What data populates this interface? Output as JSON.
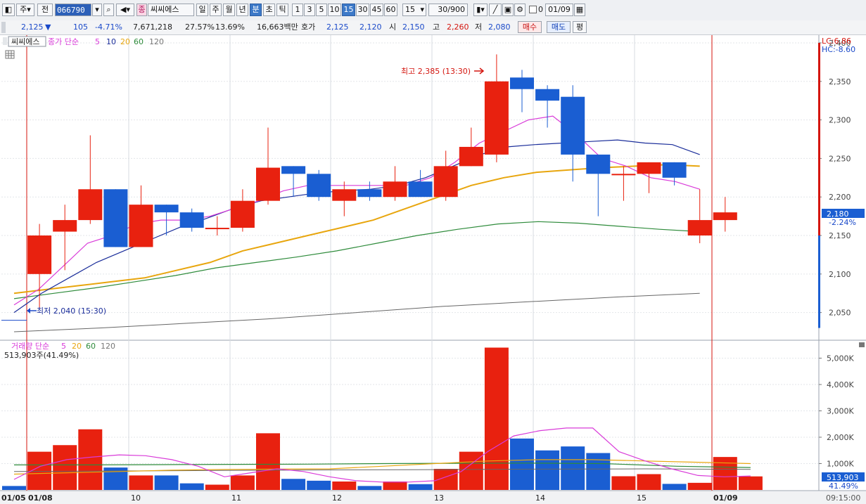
{
  "toolbar": {
    "market_btn": "주",
    "prev_btn": "전",
    "code_value": "066790",
    "stock_tag": "종",
    "stock_name": "씨씨에스",
    "period_tabs": [
      "일",
      "주",
      "월",
      "년",
      "분",
      "초",
      "틱"
    ],
    "active_period": "분",
    "interval_tabs": [
      "1",
      "3",
      "5",
      "10",
      "15",
      "30",
      "45",
      "60"
    ],
    "active_interval": "15",
    "interval_select": "15",
    "count_value": "30/900",
    "checkbox_label": "0",
    "date_value": "01/09"
  },
  "info": {
    "price": "2,125",
    "down_arrow": "▼",
    "change": "105",
    "change_pct": "-4.71%",
    "volume": "7,671,218",
    "turnover_pct": "27.57%",
    "ratio_pct": "13.69%",
    "amount": "16,663백만",
    "quote_label": "호가",
    "ask": "2,125",
    "bid": "2,120",
    "open_label": "시",
    "open": "2,150",
    "high_label": "고",
    "high": "2,260",
    "low_label": "저",
    "low": "2,080",
    "buy_btn": "매수",
    "sell_btn": "매도",
    "eval_btn": "평"
  },
  "price_panel": {
    "stock_label": "씨씨에스",
    "legend_prefix": "종가 단순",
    "ma_labels": [
      "5",
      "10",
      "20",
      "60",
      "120"
    ],
    "lc_label": "LC:6.86",
    "hc_label": "HC:-8.60",
    "max_annotation": "최고 2,385 (13:30)",
    "min_annotation": "최저 2,040 (15:30)",
    "current_price_tag": "2,180",
    "current_pct_tag": "-2.24%"
  },
  "volume_panel": {
    "legend_prefix": "거래량 단순",
    "ma_labels": [
      "5",
      "20",
      "60",
      "120"
    ],
    "volume_summary": "513,903주(41.49%)",
    "current_volume_tag": "513,903",
    "current_pct_tag": "41.49%"
  },
  "time_axis": {
    "labels": [
      "01/05",
      "01/08",
      "10",
      "11",
      "12",
      "13",
      "14",
      "15",
      "01/09"
    ],
    "clock": "09:15:00"
  },
  "colors": {
    "up": "#e8210f",
    "down": "#1a5ed2",
    "ma5": "#d93bd9",
    "ma10": "#1a2d9a",
    "ma20": "#e8a60e",
    "ma60": "#2e8b3b",
    "ma120": "#666666"
  },
  "chart_data": {
    "type": "candlestick",
    "price_axis": {
      "ticks": [
        2050,
        2100,
        2150,
        2200,
        2250,
        2300,
        2350,
        2400
      ],
      "ylim": [
        2015,
        2410
      ]
    },
    "volume_axis": {
      "ticks": [
        "1,000K",
        "2,000K",
        "3,000K",
        "4,000K",
        "5,000K"
      ],
      "ylim": [
        0,
        5600
      ]
    },
    "candles": [
      {
        "o": 2100,
        "h": 2165,
        "l": 2055,
        "c": 2150
      },
      {
        "o": 2155,
        "h": 2190,
        "l": 2105,
        "c": 2170
      },
      {
        "o": 2170,
        "h": 2280,
        "l": 2165,
        "c": 2210
      },
      {
        "o": 2210,
        "h": 2210,
        "l": 2135,
        "c": 2135
      },
      {
        "o": 2135,
        "h": 2215,
        "l": 2135,
        "c": 2190
      },
      {
        "o": 2190,
        "h": 2190,
        "l": 2150,
        "c": 2180
      },
      {
        "o": 2180,
        "h": 2185,
        "l": 2155,
        "c": 2160
      },
      {
        "o": 2160,
        "h": 2175,
        "l": 2150,
        "c": 2160
      },
      {
        "o": 2160,
        "h": 2210,
        "l": 2155,
        "c": 2195
      },
      {
        "o": 2195,
        "h": 2290,
        "l": 2190,
        "c": 2238
      },
      {
        "o": 2240,
        "h": 2240,
        "l": 2200,
        "c": 2230
      },
      {
        "o": 2230,
        "h": 2235,
        "l": 2195,
        "c": 2200
      },
      {
        "o": 2195,
        "h": 2220,
        "l": 2175,
        "c": 2210
      },
      {
        "o": 2210,
        "h": 2220,
        "l": 2195,
        "c": 2200
      },
      {
        "o": 2200,
        "h": 2240,
        "l": 2195,
        "c": 2220
      },
      {
        "o": 2220,
        "h": 2235,
        "l": 2200,
        "c": 2200
      },
      {
        "o": 2200,
        "h": 2260,
        "l": 2195,
        "c": 2240
      },
      {
        "o": 2240,
        "h": 2290,
        "l": 2240,
        "c": 2265
      },
      {
        "o": 2255,
        "h": 2385,
        "l": 2245,
        "c": 2350
      },
      {
        "o": 2355,
        "h": 2365,
        "l": 2310,
        "c": 2340
      },
      {
        "o": 2340,
        "h": 2345,
        "l": 2290,
        "c": 2325
      },
      {
        "o": 2330,
        "h": 2345,
        "l": 2220,
        "c": 2255
      },
      {
        "o": 2255,
        "h": 2255,
        "l": 2175,
        "c": 2230
      },
      {
        "o": 2230,
        "h": 2240,
        "l": 2195,
        "c": 2230
      },
      {
        "o": 2230,
        "h": 2245,
        "l": 2205,
        "c": 2245
      },
      {
        "o": 2245,
        "h": 2245,
        "l": 2215,
        "c": 2225
      },
      {
        "o": 2150,
        "h": 2210,
        "l": 2140,
        "c": 2170
      },
      {
        "o": 2170,
        "h": 2200,
        "l": 2155,
        "c": 2180
      }
    ],
    "volumes": [
      150,
      1450,
      1700,
      2300,
      850,
      550,
      550,
      250,
      200,
      550,
      2150,
      420,
      350,
      320,
      150,
      320,
      220,
      800,
      1450,
      5400,
      1950,
      1500,
      1650,
      1400,
      520,
      600,
      230,
      270,
      1250,
      514
    ],
    "ma5": [
      2060,
      2080,
      2110,
      2140,
      2150,
      2165,
      2170,
      2170,
      2175,
      2185,
      2195,
      2208,
      2215,
      2215,
      2215,
      2215,
      2215,
      2225,
      2245,
      2270,
      2285,
      2300,
      2305,
      2280,
      2250,
      2240,
      2225,
      2220,
      2210
    ],
    "ma10": [
      2050,
      2075,
      2095,
      2115,
      2130,
      2145,
      2160,
      2172,
      2185,
      2195,
      2200,
      2205,
      2208,
      2210,
      2215,
      2225,
      2240,
      2255,
      2265,
      2268,
      2270,
      2272,
      2274,
      2270,
      2268,
      2255
    ],
    "ma20": [
      2075,
      2080,
      2085,
      2090,
      2095,
      2105,
      2115,
      2130,
      2140,
      2150,
      2160,
      2170,
      2185,
      2200,
      2215,
      2225,
      2232,
      2235,
      2238,
      2240,
      2242,
      2240
    ],
    "ma60": [
      2068,
      2075,
      2082,
      2090,
      2098,
      2108,
      2115,
      2122,
      2130,
      2140,
      2150,
      2158,
      2165,
      2168,
      2166,
      2162,
      2158,
      2155
    ],
    "ma120": [
      2025,
      2030,
      2036,
      2042,
      2050,
      2058,
      2064,
      2070,
      2075
    ],
    "vol_ma": {
      "ma5": [
        400,
        900,
        1150,
        1250,
        1330,
        1300,
        1150,
        900,
        500,
        650,
        800,
        700,
        500,
        350,
        300,
        300,
        350,
        700,
        1450,
        2050,
        2250,
        2350,
        2350,
        1450,
        1100,
        800,
        550,
        500,
        530
      ],
      "ma20": [
        600,
        650,
        700,
        750,
        780,
        790,
        800,
        900,
        1000,
        1100,
        1150,
        1150,
        1100,
        1050,
        1000
      ],
      "ma60": [
        950,
        950,
        960,
        970,
        980,
        1000,
        1010,
        1020,
        1000,
        900,
        850
      ],
      "ma120": [
        700,
        720,
        740,
        760,
        770,
        790,
        800,
        780
      ]
    },
    "max": {
      "value": 2385,
      "time": "13:30"
    },
    "min": {
      "value": 2040,
      "time": "15:30"
    }
  }
}
